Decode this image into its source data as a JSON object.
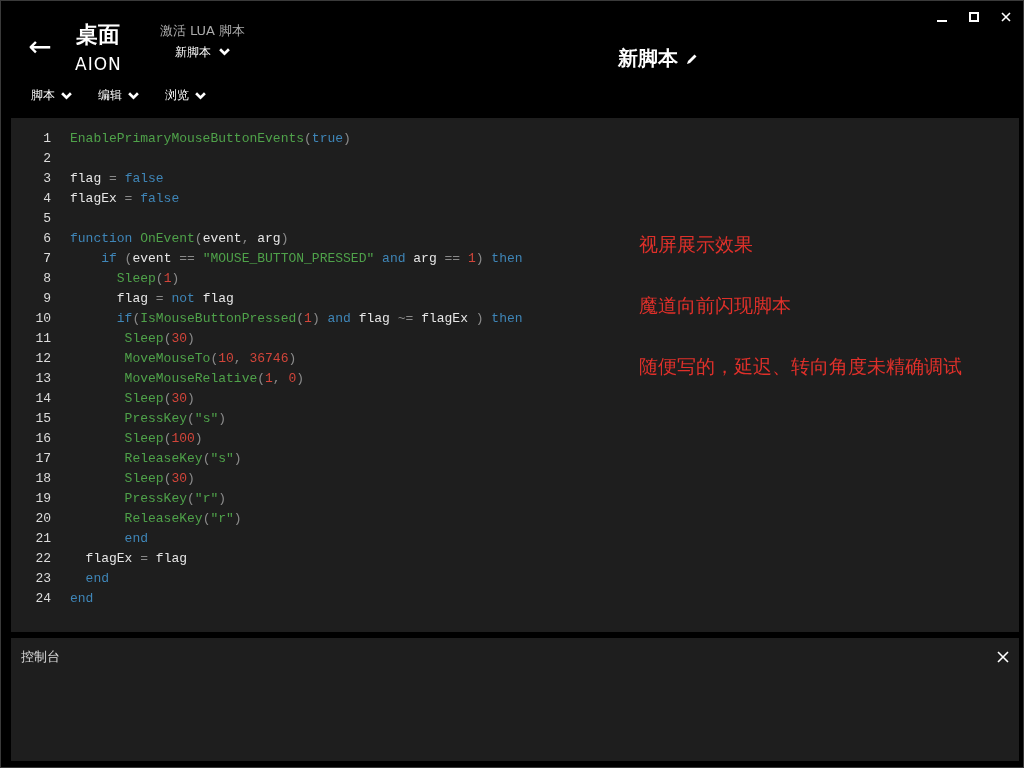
{
  "header": {
    "back": "←",
    "app_title": "桌面",
    "app_subtitle": "AION",
    "activate_label": "激活 LUA 脚本",
    "script_selector": "新脚本",
    "script_name": "新脚本"
  },
  "menu": [
    {
      "label": "脚本"
    },
    {
      "label": "编辑"
    },
    {
      "label": "浏览"
    }
  ],
  "editor": {
    "lines": [
      {
        "number": "1",
        "tokens": [
          {
            "kind": "func",
            "text": "EnablePrimaryMouseButtonEvents"
          },
          {
            "kind": "op",
            "text": "("
          },
          {
            "kind": "keyword",
            "text": "true"
          },
          {
            "kind": "op",
            "text": ")"
          }
        ]
      },
      {
        "number": "2"
      },
      {
        "number": "3",
        "tokens": [
          {
            "kind": "plain",
            "text": "flag "
          },
          {
            "kind": "op",
            "text": "= "
          },
          {
            "kind": "keyword",
            "text": "false"
          }
        ]
      },
      {
        "number": "4",
        "tokens": [
          {
            "kind": "plain",
            "text": "flagEx "
          },
          {
            "kind": "op",
            "text": "= "
          },
          {
            "kind": "keyword",
            "text": "false"
          }
        ]
      },
      {
        "number": "5"
      },
      {
        "number": "6",
        "tokens": [
          {
            "kind": "keyword",
            "text": "function "
          },
          {
            "kind": "func",
            "text": "OnEvent"
          },
          {
            "kind": "op",
            "text": "("
          },
          {
            "kind": "plain",
            "text": "event"
          },
          {
            "kind": "op",
            "text": ", "
          },
          {
            "kind": "plain",
            "text": "arg"
          },
          {
            "kind": "op",
            "text": ")"
          }
        ]
      },
      {
        "number": "7",
        "tokens": [
          {
            "kind": "keyword",
            "text": "    if "
          },
          {
            "kind": "op",
            "text": "("
          },
          {
            "kind": "plain",
            "text": "event "
          },
          {
            "kind": "op",
            "text": "== "
          },
          {
            "kind": "string",
            "text": "\"MOUSE_BUTTON_PRESSED\""
          },
          {
            "kind": "keyword",
            "text": " and "
          },
          {
            "kind": "plain",
            "text": "arg "
          },
          {
            "kind": "op",
            "text": "== "
          },
          {
            "kind": "number",
            "text": "1"
          },
          {
            "kind": "op",
            "text": ") "
          },
          {
            "kind": "keyword",
            "text": "then"
          }
        ]
      },
      {
        "number": "8",
        "tokens": [
          {
            "kind": "func",
            "text": "      Sleep"
          },
          {
            "kind": "op",
            "text": "("
          },
          {
            "kind": "number",
            "text": "1"
          },
          {
            "kind": "op",
            "text": ")"
          }
        ]
      },
      {
        "number": "9",
        "tokens": [
          {
            "kind": "plain",
            "text": "      flag "
          },
          {
            "kind": "op",
            "text": "= "
          },
          {
            "kind": "keyword",
            "text": "not "
          },
          {
            "kind": "plain",
            "text": "flag"
          }
        ]
      },
      {
        "number": "10",
        "tokens": [
          {
            "kind": "keyword",
            "text": "      if"
          },
          {
            "kind": "op",
            "text": "("
          },
          {
            "kind": "func",
            "text": "IsMouseButtonPressed"
          },
          {
            "kind": "op",
            "text": "("
          },
          {
            "kind": "number",
            "text": "1"
          },
          {
            "kind": "op",
            "text": ") "
          },
          {
            "kind": "keyword",
            "text": "and "
          },
          {
            "kind": "plain",
            "text": "flag "
          },
          {
            "kind": "op",
            "text": "~= "
          },
          {
            "kind": "plain",
            "text": "flagEx "
          },
          {
            "kind": "op",
            "text": ") "
          },
          {
            "kind": "keyword",
            "text": "then"
          }
        ]
      },
      {
        "number": "11",
        "tokens": [
          {
            "kind": "func",
            "text": "       Sleep"
          },
          {
            "kind": "op",
            "text": "("
          },
          {
            "kind": "number",
            "text": "30"
          },
          {
            "kind": "op",
            "text": ")"
          }
        ]
      },
      {
        "number": "12",
        "tokens": [
          {
            "kind": "func",
            "text": "       MoveMouseTo"
          },
          {
            "kind": "op",
            "text": "("
          },
          {
            "kind": "number",
            "text": "10"
          },
          {
            "kind": "op",
            "text": ", "
          },
          {
            "kind": "number",
            "text": "36746"
          },
          {
            "kind": "op",
            "text": ")"
          }
        ]
      },
      {
        "number": "13",
        "tokens": [
          {
            "kind": "func",
            "text": "       MoveMouseRelative"
          },
          {
            "kind": "op",
            "text": "("
          },
          {
            "kind": "number",
            "text": "1"
          },
          {
            "kind": "op",
            "text": ", "
          },
          {
            "kind": "number",
            "text": "0"
          },
          {
            "kind": "op",
            "text": ")"
          }
        ]
      },
      {
        "number": "14",
        "tokens": [
          {
            "kind": "func",
            "text": "       Sleep"
          },
          {
            "kind": "op",
            "text": "("
          },
          {
            "kind": "number",
            "text": "30"
          },
          {
            "kind": "op",
            "text": ")"
          }
        ]
      },
      {
        "number": "15",
        "tokens": [
          {
            "kind": "func",
            "text": "       PressKey"
          },
          {
            "kind": "op",
            "text": "("
          },
          {
            "kind": "string",
            "text": "\"s\""
          },
          {
            "kind": "op",
            "text": ")"
          }
        ]
      },
      {
        "number": "16",
        "tokens": [
          {
            "kind": "func",
            "text": "       Sleep"
          },
          {
            "kind": "op",
            "text": "("
          },
          {
            "kind": "number",
            "text": "100"
          },
          {
            "kind": "op",
            "text": ")"
          }
        ]
      },
      {
        "number": "17",
        "tokens": [
          {
            "kind": "func",
            "text": "       ReleaseKey"
          },
          {
            "kind": "op",
            "text": "("
          },
          {
            "kind": "string",
            "text": "\"s\""
          },
          {
            "kind": "op",
            "text": ")"
          }
        ]
      },
      {
        "number": "18",
        "tokens": [
          {
            "kind": "func",
            "text": "       Sleep"
          },
          {
            "kind": "op",
            "text": "("
          },
          {
            "kind": "number",
            "text": "30"
          },
          {
            "kind": "op",
            "text": ")"
          }
        ]
      },
      {
        "number": "19",
        "tokens": [
          {
            "kind": "func",
            "text": "       PressKey"
          },
          {
            "kind": "op",
            "text": "("
          },
          {
            "kind": "string",
            "text": "\"r\""
          },
          {
            "kind": "op",
            "text": ")"
          }
        ]
      },
      {
        "number": "20",
        "tokens": [
          {
            "kind": "func",
            "text": "       ReleaseKey"
          },
          {
            "kind": "op",
            "text": "("
          },
          {
            "kind": "string",
            "text": "\"r\""
          },
          {
            "kind": "op",
            "text": ")"
          }
        ]
      },
      {
        "number": "21",
        "tokens": [
          {
            "kind": "keyword",
            "text": "       end"
          }
        ]
      },
      {
        "number": "22",
        "tokens": [
          {
            "kind": "plain",
            "text": "  flagEx "
          },
          {
            "kind": "op",
            "text": "= "
          },
          {
            "kind": "plain",
            "text": "flag"
          }
        ]
      },
      {
        "number": "23",
        "tokens": [
          {
            "kind": "keyword",
            "text": "  end"
          }
        ]
      },
      {
        "number": "24",
        "tokens": [
          {
            "kind": "keyword",
            "text": "end"
          }
        ]
      }
    ],
    "notes": [
      "视屏展示效果",
      "魔道向前闪现脚本",
      "随便写的，延迟、转向角度未精确调试"
    ]
  },
  "console": {
    "title": "控制台"
  }
}
